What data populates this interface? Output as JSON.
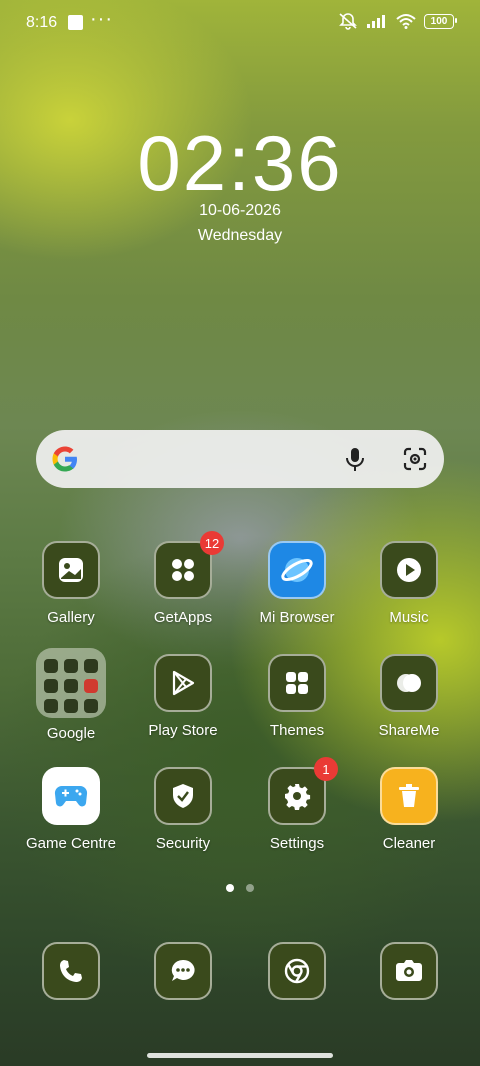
{
  "status_bar": {
    "time": "8:16",
    "dots": "···",
    "battery": "100",
    "icons": [
      "notification-square-icon",
      "mute-icon",
      "signal-icon",
      "wifi-icon",
      "battery-icon"
    ]
  },
  "lockscreen_clock": {
    "time": "02:36",
    "date": "10-06-2026",
    "day": "Wednesday"
  },
  "search_bar": {
    "icons": [
      "google-g-icon",
      "microphone-icon",
      "google-lens-icon"
    ]
  },
  "apps": [
    {
      "label": "Gallery",
      "icon": "gallery-icon"
    },
    {
      "label": "GetApps",
      "icon": "getapps-icon",
      "badge": "12"
    },
    {
      "label": "Mi Browser",
      "icon": "mi-browser-icon"
    },
    {
      "label": "Music",
      "icon": "music-icon"
    },
    {
      "label": "Google",
      "icon": "google-folder-icon"
    },
    {
      "label": "Play Store",
      "icon": "play-store-icon"
    },
    {
      "label": "Themes",
      "icon": "themes-icon"
    },
    {
      "label": "ShareMe",
      "icon": "shareme-icon"
    },
    {
      "label": "Game Centre",
      "icon": "game-centre-icon"
    },
    {
      "label": "Security",
      "icon": "security-icon"
    },
    {
      "label": "Settings",
      "icon": "settings-icon",
      "badge": "1"
    },
    {
      "label": "Cleaner",
      "icon": "cleaner-icon"
    }
  ],
  "page_indicator": {
    "pages": 2,
    "current": 1
  },
  "dock": [
    {
      "icon": "phone-icon"
    },
    {
      "icon": "messages-icon"
    },
    {
      "icon": "chrome-icon"
    },
    {
      "icon": "camera-icon"
    }
  ],
  "colors": {
    "icon_bg": "#3a4a1c",
    "badge": "#ea3a35",
    "accent_blue": "#1e88e5",
    "accent_yellow": "#f7b21e"
  }
}
